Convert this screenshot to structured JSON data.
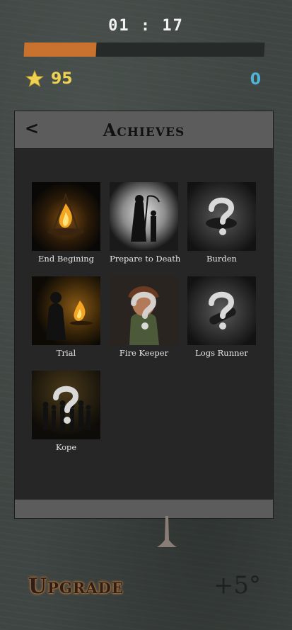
{
  "hud": {
    "timer": "01 : 17",
    "progress": 0.3,
    "stars": "95",
    "currency": "0",
    "progress_color": "#c9712e",
    "star_color": "#f0d253",
    "currency_color": "#4fb4d8"
  },
  "panel": {
    "back_label": "<",
    "title": "Achieves",
    "achievements": [
      {
        "label": "End Begining",
        "icon": "campfire-image",
        "locked": false
      },
      {
        "label": "Prepare to Death",
        "icon": "reaper-image",
        "locked": false
      },
      {
        "label": "Burden",
        "icon": "question-mark-icon",
        "locked": true
      },
      {
        "label": "Trial",
        "icon": "silhouette-fire-image",
        "locked": false
      },
      {
        "label": "Fire Keeper",
        "icon": "question-mark-icon",
        "locked": true
      },
      {
        "label": "Logs Runner",
        "icon": "question-mark-icon",
        "locked": true
      },
      {
        "label": "Kope",
        "icon": "question-mark-icon",
        "locked": true
      }
    ]
  },
  "footer": {
    "upgrade_label": "Upgrade",
    "temperature": "+5°"
  }
}
